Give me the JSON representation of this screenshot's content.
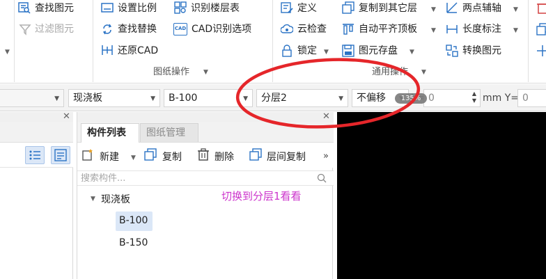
{
  "ribbon": {
    "col1": {
      "find_element": "查找图元",
      "filter_element": "过滤图元"
    },
    "drawing_ops": {
      "set_scale": "设置比例",
      "find_replace": "查找替换",
      "restore_cad": "还原CAD",
      "recognize_floor_table": "识别楼层表",
      "cad_recognize_options": "CAD识别选项",
      "group_label": "图纸操作"
    },
    "common_ops": {
      "define": "定义",
      "cloud_check": "云检查",
      "lock": "锁定",
      "copy_to_other_layer": "复制到其它层",
      "auto_align_top": "自动平齐顶板",
      "element_save": "图元存盘",
      "two_point_axis": "两点辅轴",
      "length_dimension": "长度标注",
      "convert_element": "转换图元",
      "group_label": "通用操作"
    },
    "icon_cad_text": "CAD"
  },
  "toolbar": {
    "type_value": "现浇板",
    "name_value": "B-100",
    "layer_value": "分层2",
    "move_value": "不偏移",
    "x_label": "X=",
    "x_value": "0",
    "unit_y_label": "mm Y=",
    "y_value": "0",
    "zoom_badge": "135%"
  },
  "panel": {
    "tab_component_list": "构件列表",
    "tab_drawing_mgmt": "图纸管理",
    "btn_new": "新建",
    "btn_copy": "复制",
    "btn_delete": "删除",
    "btn_copy_between_layers": "层间复制",
    "more": "»",
    "search_placeholder": "搜索构件...",
    "tree_root": "现浇板",
    "items": [
      "B-100",
      "B-150"
    ]
  },
  "annotation": {
    "text": "切换到分层1看看",
    "text_color": "#cc33cc",
    "circle_color": "#e5262a"
  },
  "colors": {
    "accent_blue": "#2b73c5",
    "selected_bg": "#dbe7f7",
    "canvas_bg": "#000000"
  }
}
